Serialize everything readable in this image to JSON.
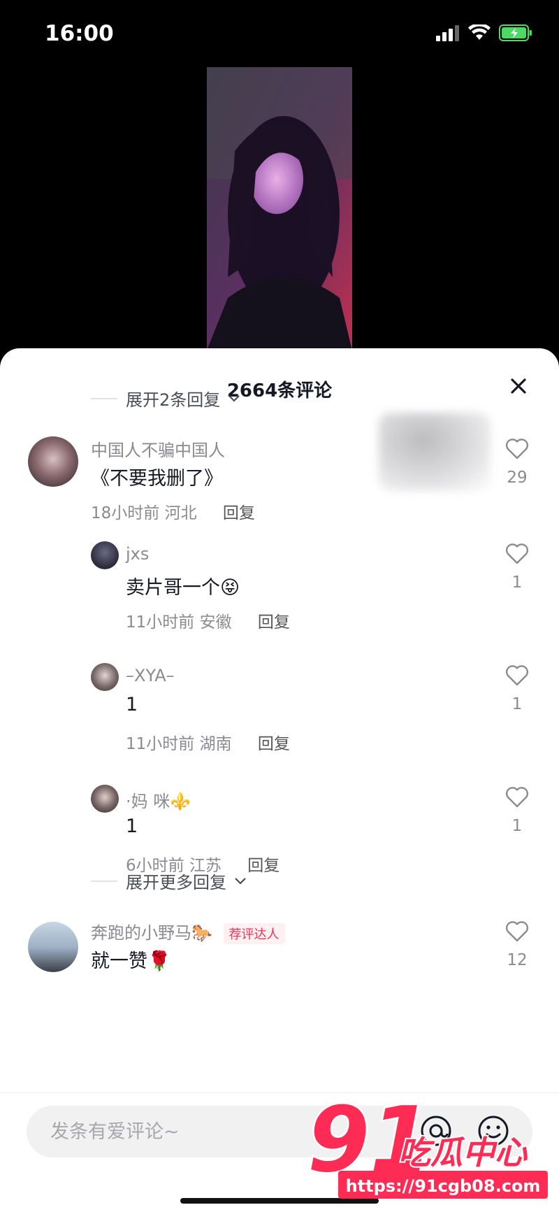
{
  "status_bar": {
    "time": "16:00"
  },
  "sheet": {
    "title": "2664条评论",
    "expand_top": "展开2条回复",
    "expand_more": "展开更多回复"
  },
  "comments": [
    {
      "user": "中国人不骗中国人",
      "text": "《不要我删了》",
      "time": "18小时前",
      "location": "河北",
      "reply": "回复",
      "likes": "29"
    },
    {
      "user": "jxs",
      "text": "卖片哥一个😝",
      "time": "11小时前",
      "location": "安徽",
      "reply": "回复",
      "likes": "1"
    },
    {
      "user": "–XYA–",
      "text": "1",
      "time": "11小时前",
      "location": "湖南",
      "reply": "回复",
      "likes": "1"
    },
    {
      "user": "·妈 咪⚜️",
      "text": "1",
      "time": "6小时前",
      "location": "江苏",
      "reply": "回复",
      "likes": "1"
    },
    {
      "user": "奔跑的小野马🐎",
      "badge": "荐评达人",
      "text": "就一赞🌹",
      "likes": "12"
    }
  ],
  "input": {
    "placeholder": "发条有爱评论~"
  },
  "watermark": {
    "number": "91",
    "text": "吃瓜中心",
    "url": "https://91cgb08.com"
  },
  "colors": {
    "accent": "#fe2c55",
    "secondary_text": "#8a8b91",
    "sheet_bg": "#ffffff"
  },
  "icons": [
    "signal-icon",
    "wifi-icon",
    "battery-icon",
    "close-icon",
    "chevron-down-icon",
    "heart-icon",
    "at-icon",
    "emoji-icon"
  ]
}
